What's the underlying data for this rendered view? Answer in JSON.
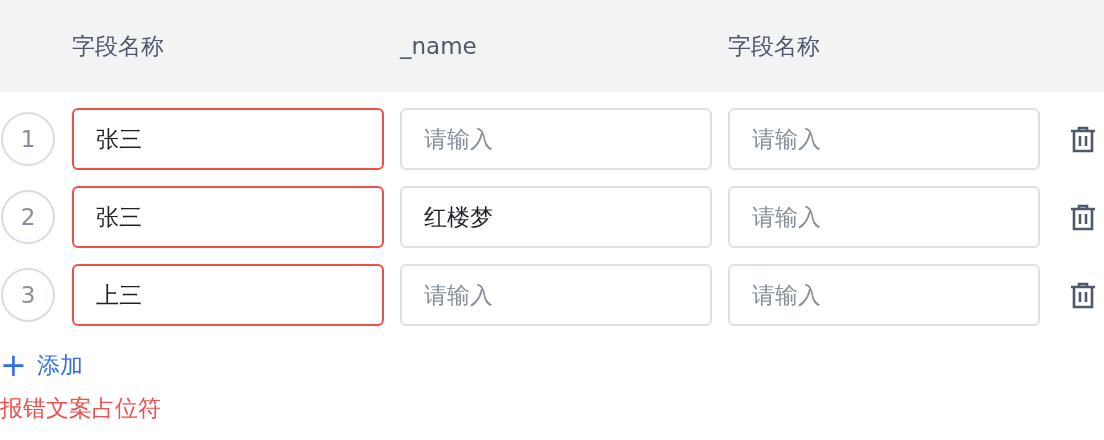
{
  "table": {
    "columns": [
      "字段名称",
      "_name",
      "字段名称"
    ],
    "rows": [
      {
        "index": "1",
        "cells": [
          {
            "value": "张三",
            "error": true
          },
          {
            "placeholder": "请输入",
            "error": false
          },
          {
            "placeholder": "请输入",
            "error": false
          }
        ]
      },
      {
        "index": "2",
        "cells": [
          {
            "value": "张三",
            "error": true
          },
          {
            "value": "红楼梦",
            "error": false
          },
          {
            "placeholder": "请输入",
            "error": false
          }
        ]
      },
      {
        "index": "3",
        "cells": [
          {
            "value": "上三",
            "error": true
          },
          {
            "placeholder": "请输入",
            "error": false
          },
          {
            "placeholder": "请输入",
            "error": false
          }
        ]
      }
    ]
  },
  "add_button": {
    "icon": "+",
    "label": "添加"
  },
  "error_message": "报错文案占位符"
}
